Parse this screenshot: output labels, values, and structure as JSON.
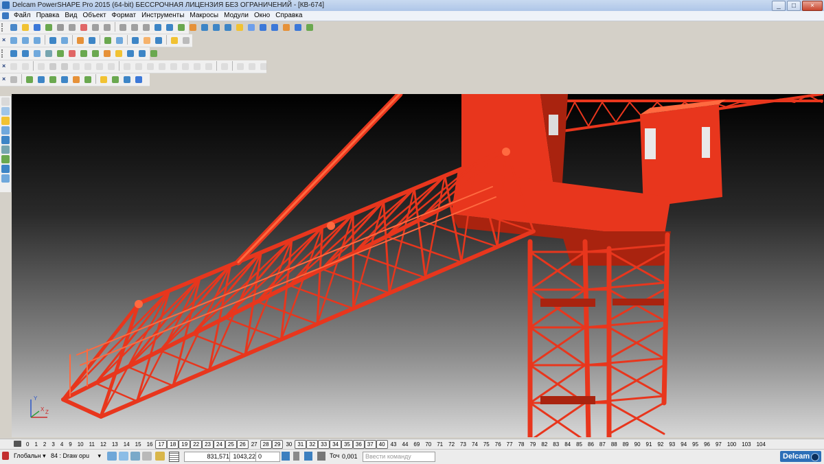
{
  "window": {
    "title": "Delcam PowerSHAPE Pro 2015 (64-bit) БЕССРОЧНАЯ ЛИЦЕНЗИЯ БЕЗ ОГРАНИЧЕНИЙ - [КВ-674]",
    "minimize": "_",
    "maximize": "□",
    "close": "×"
  },
  "menu": [
    "Файл",
    "Правка",
    "Вид",
    "Объект",
    "Формат",
    "Инструменты",
    "Макросы",
    "Модули",
    "Окно",
    "Справка"
  ],
  "levels": {
    "items": [
      "0",
      "1",
      "2",
      "3",
      "4",
      "9",
      "10",
      "11",
      "12",
      "13",
      "14",
      "15",
      "16",
      "17",
      "18",
      "19",
      "22",
      "23",
      "24",
      "25",
      "26",
      "27",
      "28",
      "29",
      "30",
      "31",
      "32",
      "33",
      "34",
      "35",
      "36",
      "37",
      "40",
      "43",
      "44",
      "69",
      "70",
      "71",
      "72",
      "73",
      "74",
      "75",
      "76",
      "77",
      "78",
      "79",
      "82",
      "83",
      "84",
      "85",
      "86",
      "87",
      "88",
      "89",
      "90",
      "91",
      "92",
      "93",
      "94",
      "95",
      "96",
      "97",
      "100",
      "103",
      "104"
    ],
    "boxed": [
      "17",
      "18",
      "19",
      "22",
      "23",
      "24",
      "25",
      "26",
      "28",
      "29",
      "31",
      "32",
      "33",
      "34",
      "35",
      "36",
      "37",
      "40"
    ]
  },
  "status": {
    "workplane": "Глобальн",
    "level": "84 : Draw opu",
    "x": "831,571",
    "y": "1043,22",
    "z": "0",
    "tolerance_label": "Точ",
    "tolerance": "0,001",
    "command_placeholder": "Ввести команду",
    "brand": "Delcam"
  },
  "colors": {
    "crane": "#e8361d",
    "crane_dark": "#a9230f",
    "crane_light": "#ff6a40"
  }
}
